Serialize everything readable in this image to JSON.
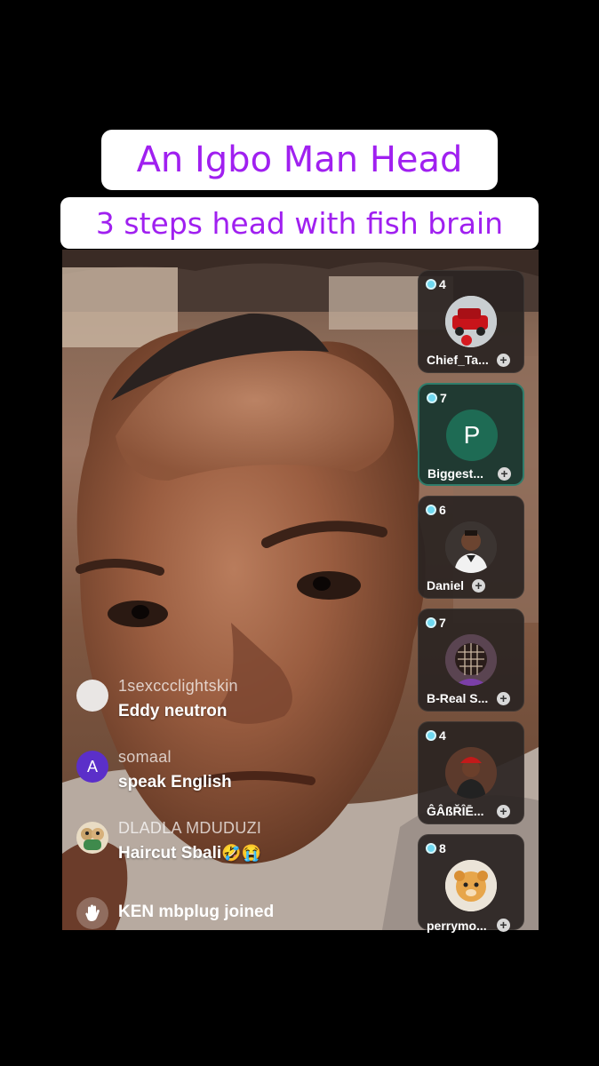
{
  "captions": {
    "title": "An Igbo Man Head",
    "subtitle": "3 steps head with fish brain"
  },
  "chat": [
    {
      "user": "1sexccclightskin",
      "text": "Eddy neutron",
      "avatar": "blank-avatar"
    },
    {
      "user": "somaal",
      "text": "speak English",
      "avatar_letter": "A"
    },
    {
      "user": "DLADLA MDUDUZI",
      "text": "Haircut Sbali",
      "emoji": "🤣😭",
      "avatar": "cartoon-avatar"
    }
  ],
  "joined": {
    "user": "KEN mbplug",
    "suffix": " joined",
    "icon": "wave-icon"
  },
  "guests": [
    {
      "count": "4",
      "name": "Chief_Ta...",
      "avatar": "red-car-avatar"
    },
    {
      "count": "7",
      "name": "Biggest...",
      "avatar_letter": "P"
    },
    {
      "count": "6",
      "name": "Daniel",
      "avatar": "man-portrait-avatar"
    },
    {
      "count": "7",
      "name": "B-Real S...",
      "avatar": "braids-avatar"
    },
    {
      "count": "4",
      "name": "ĜÂßŘÎĒ...",
      "avatar": "red-hat-avatar"
    },
    {
      "count": "8",
      "name": "perrymo...",
      "avatar": "cartoon-dog-avatar"
    }
  ],
  "colors": {
    "caption_text": "#a020f0",
    "live_dot": "#6fd8f0",
    "highlight_border": "#2f7d6b",
    "letter_avatar_purple": "#5b2fc9",
    "letter_avatar_green": "#1e6b54"
  }
}
